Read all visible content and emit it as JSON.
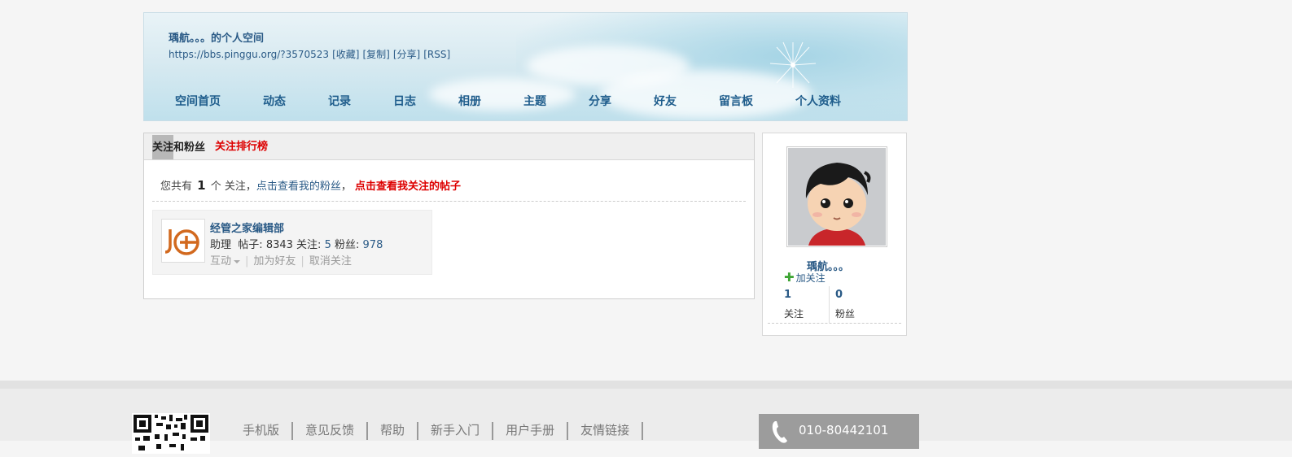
{
  "header": {
    "title": "瑀航。。。的个人空间",
    "url": "https://bbs.pinggu.org/?3570523",
    "links": [
      "[收藏]",
      "[复制]",
      "[分享]",
      "[RSS]"
    ]
  },
  "nav": [
    "空间首页",
    "动态",
    "记录",
    "日志",
    "相册",
    "主题",
    "分享",
    "好友",
    "留言板",
    "个人资料"
  ],
  "main": {
    "tab_active_part1": "关注",
    "tab_active_part2": "和粉丝",
    "tab_rank": "关注排行榜",
    "summary": {
      "prefix": "您共有",
      "count": "1",
      "suffix": "个 关注，",
      "fans_link": "点击查看我的粉丝",
      "comma": "，",
      "posts_link": "点击查看我关注的帖子"
    },
    "card": {
      "name": "经管之家编辑部",
      "role": "助理",
      "posts_label": "帖子:",
      "posts": "8343",
      "follow_label": "关注:",
      "follow": "5",
      "fans_label": "粉丝:",
      "fans": "978",
      "action_interact": "互动",
      "action_add": "加为好友",
      "action_unfollow": "取消关注"
    }
  },
  "profile": {
    "name": "瑀航。。。",
    "follow_button": "加关注",
    "following_count": "1",
    "following_label": "关注",
    "fans_count": "0",
    "fans_label": "粉丝"
  },
  "footer": {
    "links": [
      "手机版",
      "意见反馈",
      "帮助",
      "新手入门",
      "用户手册",
      "友情链接"
    ],
    "phone": "010-80442101"
  },
  "colors": {
    "link": "#2a5a86",
    "accent_red": "#dd0000",
    "nav": "#1f5d8c"
  }
}
